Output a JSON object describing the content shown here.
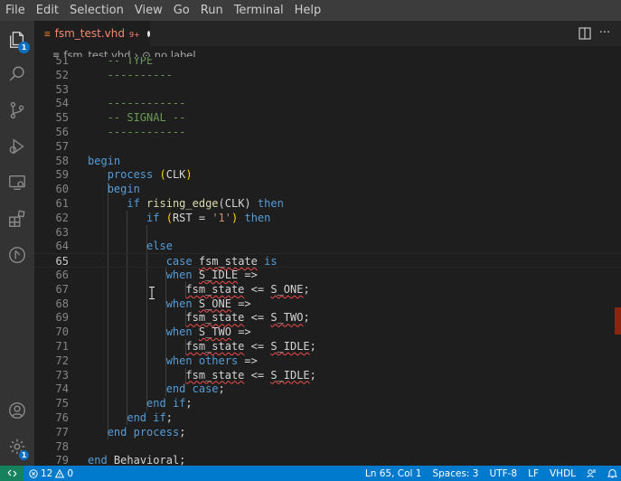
{
  "menu": [
    "File",
    "Edit",
    "Selection",
    "View",
    "Go",
    "Run",
    "Terminal",
    "Help"
  ],
  "activity": {
    "explorer_badge": "1"
  },
  "tab": {
    "file_icon": "≡",
    "label": "fsm_test.vhd",
    "problem_count": "9+"
  },
  "breadcrumb": {
    "file": "fsm_test.vhd",
    "separator": "›",
    "symbol_icon": "⊙",
    "symbol": "no label"
  },
  "editor": {
    "current_line": 65,
    "lines": [
      {
        "n": "51",
        "parts": [
          {
            "t": "   -- TYPE",
            "c": "cm"
          }
        ]
      },
      {
        "n": "52",
        "parts": [
          {
            "t": "   ----------",
            "c": "cm"
          }
        ]
      },
      {
        "n": "53",
        "parts": []
      },
      {
        "n": "54",
        "parts": [
          {
            "t": "   ------------",
            "c": "cm"
          }
        ]
      },
      {
        "n": "55",
        "parts": [
          {
            "t": "   -- SIGNAL --",
            "c": "cm"
          }
        ]
      },
      {
        "n": "56",
        "parts": [
          {
            "t": "   ------------",
            "c": "cm"
          }
        ]
      },
      {
        "n": "57",
        "parts": []
      },
      {
        "n": "58",
        "parts": [
          {
            "t": "begin",
            "c": "kw"
          }
        ]
      },
      {
        "n": "59",
        "parts": [
          {
            "t": "   ",
            "c": "plain"
          },
          {
            "t": "process",
            "c": "kw"
          },
          {
            "t": " ",
            "c": "plain"
          },
          {
            "t": "(",
            "c": "par"
          },
          {
            "t": "CLK",
            "c": "plain"
          },
          {
            "t": ")",
            "c": "par"
          }
        ]
      },
      {
        "n": "60",
        "parts": [
          {
            "t": "   ",
            "c": "plain"
          },
          {
            "t": "begin",
            "c": "kw"
          }
        ]
      },
      {
        "n": "61",
        "parts": [
          {
            "t": "      ",
            "c": "plain"
          },
          {
            "t": "if",
            "c": "kw"
          },
          {
            "t": " ",
            "c": "plain"
          },
          {
            "t": "rising_edge",
            "c": "fn"
          },
          {
            "t": "(CLK)",
            "c": "plain"
          },
          {
            "t": " ",
            "c": "plain"
          },
          {
            "t": "then",
            "c": "kw"
          }
        ]
      },
      {
        "n": "62",
        "parts": [
          {
            "t": "         ",
            "c": "plain"
          },
          {
            "t": "if",
            "c": "kw"
          },
          {
            "t": " ",
            "c": "plain"
          },
          {
            "t": "(",
            "c": "par"
          },
          {
            "t": "RST = ",
            "c": "plain"
          },
          {
            "t": "'1'",
            "c": "str"
          },
          {
            "t": ")",
            "c": "par"
          },
          {
            "t": " ",
            "c": "plain"
          },
          {
            "t": "then",
            "c": "kw"
          }
        ]
      },
      {
        "n": "63",
        "parts": []
      },
      {
        "n": "64",
        "parts": [
          {
            "t": "         ",
            "c": "plain"
          },
          {
            "t": "else",
            "c": "kw"
          }
        ]
      },
      {
        "n": "65",
        "parts": [
          {
            "t": "            ",
            "c": "plain"
          },
          {
            "t": "case",
            "c": "kw"
          },
          {
            "t": " ",
            "c": "plain"
          },
          {
            "t": "fsm_state",
            "c": "plain squig"
          },
          {
            "t": " ",
            "c": "plain"
          },
          {
            "t": "is",
            "c": "kw"
          }
        ]
      },
      {
        "n": "66",
        "parts": [
          {
            "t": "            ",
            "c": "plain"
          },
          {
            "t": "when",
            "c": "kw"
          },
          {
            "t": " ",
            "c": "plain"
          },
          {
            "t": "S_IDLE",
            "c": "plain squig"
          },
          {
            "t": " =>",
            "c": "plain"
          }
        ]
      },
      {
        "n": "67",
        "parts": [
          {
            "t": "               ",
            "c": "plain"
          },
          {
            "t": "fsm_state",
            "c": "plain squig"
          },
          {
            "t": " <= ",
            "c": "plain"
          },
          {
            "t": "S_ONE",
            "c": "plain squig"
          },
          {
            "t": ";",
            "c": "plain"
          }
        ]
      },
      {
        "n": "68",
        "parts": [
          {
            "t": "            ",
            "c": "plain"
          },
          {
            "t": "when",
            "c": "kw"
          },
          {
            "t": " ",
            "c": "plain"
          },
          {
            "t": "S_ONE",
            "c": "plain squig"
          },
          {
            "t": " =>",
            "c": "plain"
          }
        ]
      },
      {
        "n": "69",
        "parts": [
          {
            "t": "               ",
            "c": "plain"
          },
          {
            "t": "fsm_state",
            "c": "plain squig"
          },
          {
            "t": " <= ",
            "c": "plain"
          },
          {
            "t": "S_TWO",
            "c": "plain squig"
          },
          {
            "t": ";",
            "c": "plain"
          }
        ]
      },
      {
        "n": "70",
        "parts": [
          {
            "t": "            ",
            "c": "plain"
          },
          {
            "t": "when",
            "c": "kw"
          },
          {
            "t": " ",
            "c": "plain"
          },
          {
            "t": "S_TWO",
            "c": "plain squig"
          },
          {
            "t": " =>",
            "c": "plain"
          }
        ]
      },
      {
        "n": "71",
        "parts": [
          {
            "t": "               ",
            "c": "plain"
          },
          {
            "t": "fsm_state",
            "c": "plain squig"
          },
          {
            "t": " <= ",
            "c": "plain"
          },
          {
            "t": "S_IDLE",
            "c": "plain squig"
          },
          {
            "t": ";",
            "c": "plain"
          }
        ]
      },
      {
        "n": "72",
        "parts": [
          {
            "t": "            ",
            "c": "plain"
          },
          {
            "t": "when",
            "c": "kw"
          },
          {
            "t": " ",
            "c": "plain"
          },
          {
            "t": "others",
            "c": "kw"
          },
          {
            "t": " =>",
            "c": "plain"
          }
        ]
      },
      {
        "n": "73",
        "parts": [
          {
            "t": "               ",
            "c": "plain"
          },
          {
            "t": "fsm_state",
            "c": "plain squig"
          },
          {
            "t": " <= ",
            "c": "plain"
          },
          {
            "t": "S_IDLE",
            "c": "plain squig"
          },
          {
            "t": ";",
            "c": "plain"
          }
        ]
      },
      {
        "n": "74",
        "parts": [
          {
            "t": "            ",
            "c": "plain"
          },
          {
            "t": "end",
            "c": "kw"
          },
          {
            "t": " ",
            "c": "plain"
          },
          {
            "t": "case",
            "c": "kw"
          },
          {
            "t": ";",
            "c": "plain"
          }
        ]
      },
      {
        "n": "75",
        "parts": [
          {
            "t": "         ",
            "c": "plain"
          },
          {
            "t": "end",
            "c": "kw"
          },
          {
            "t": " ",
            "c": "plain"
          },
          {
            "t": "if",
            "c": "kw"
          },
          {
            "t": ";",
            "c": "plain"
          }
        ]
      },
      {
        "n": "76",
        "parts": [
          {
            "t": "      ",
            "c": "plain"
          },
          {
            "t": "end",
            "c": "kw"
          },
          {
            "t": " ",
            "c": "plain"
          },
          {
            "t": "if",
            "c": "kw"
          },
          {
            "t": ";",
            "c": "plain"
          }
        ]
      },
      {
        "n": "77",
        "parts": [
          {
            "t": "   ",
            "c": "plain"
          },
          {
            "t": "end",
            "c": "kw"
          },
          {
            "t": " ",
            "c": "plain"
          },
          {
            "t": "process",
            "c": "kw"
          },
          {
            "t": ";",
            "c": "plain"
          }
        ]
      },
      {
        "n": "78",
        "parts": []
      },
      {
        "n": "79",
        "parts": [
          {
            "t": "end",
            "c": "kw"
          },
          {
            "t": " ",
            "c": "plain"
          },
          {
            "t": "Behavioral",
            "c": "plain"
          },
          {
            "t": ";",
            "c": "plain"
          }
        ]
      }
    ]
  },
  "status": {
    "errors": "12",
    "warnings": "0",
    "position": "Ln 65, Col 1",
    "spaces": "Spaces: 3",
    "encoding": "UTF-8",
    "eol": "LF",
    "language": "VHDL"
  },
  "colors": {
    "accent": "#007acc",
    "keyword": "#569cd6",
    "comment": "#6a9955",
    "error": "#f14c4c"
  }
}
